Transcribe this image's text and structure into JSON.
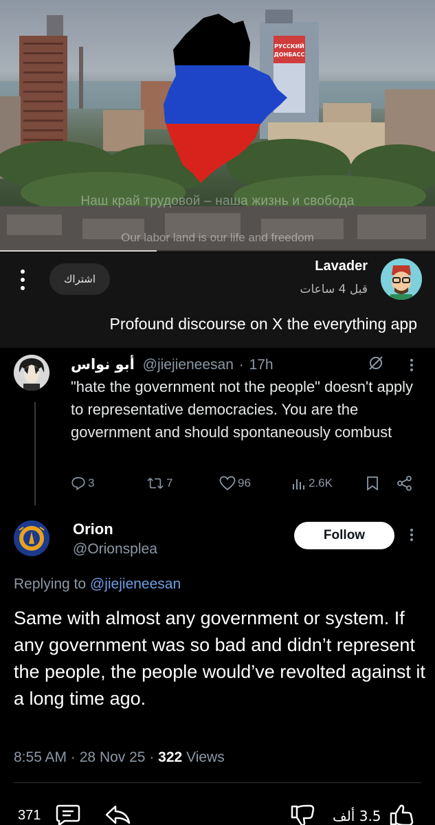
{
  "hero": {
    "caption_ru": "Наш край трудовой – наша жизнь и свобода",
    "caption_en": "Our labor land is our life and freedom",
    "billboard": "РУССКИЙ ДОНБАСС",
    "progress": 0.36
  },
  "card": {
    "subscribe_label": "اشتراك",
    "username": "Lavader",
    "time": "قبل 4 ساعات",
    "text": "Profound discourse on X the everything app"
  },
  "tweet1": {
    "name": "أبو نواس",
    "handle": "@jiejieneesan",
    "time": "17h",
    "text": "\"hate the government not the people\" doesn't apply to representative democracies. You are the government and should spontaneously combust",
    "replies": "3",
    "reposts": "7",
    "likes": "96",
    "views": "2.6K"
  },
  "tweet2": {
    "name": "Orion",
    "handle": "@Orionsplea",
    "follow_label": "Follow",
    "replying_prefix": "Replying to",
    "replying_to": "@jiejieneesan",
    "text": "Same with almost any government or system. If any government was so bad and didn’t represent the people, the people would’ve revolted against it a long time ago.",
    "time": "8:55 AM",
    "date": "28 Nov 25",
    "views_count": "322",
    "views_label": "Views"
  },
  "bottom": {
    "comments": "371",
    "likes": "3.5 ألف"
  },
  "colors": {
    "background": "#000000",
    "card": "#141414",
    "muted": "#8b98a5",
    "link": "#6e9fe6",
    "flag_black": "#000000",
    "flag_blue": "#1e45c8",
    "flag_red": "#d8231c"
  }
}
